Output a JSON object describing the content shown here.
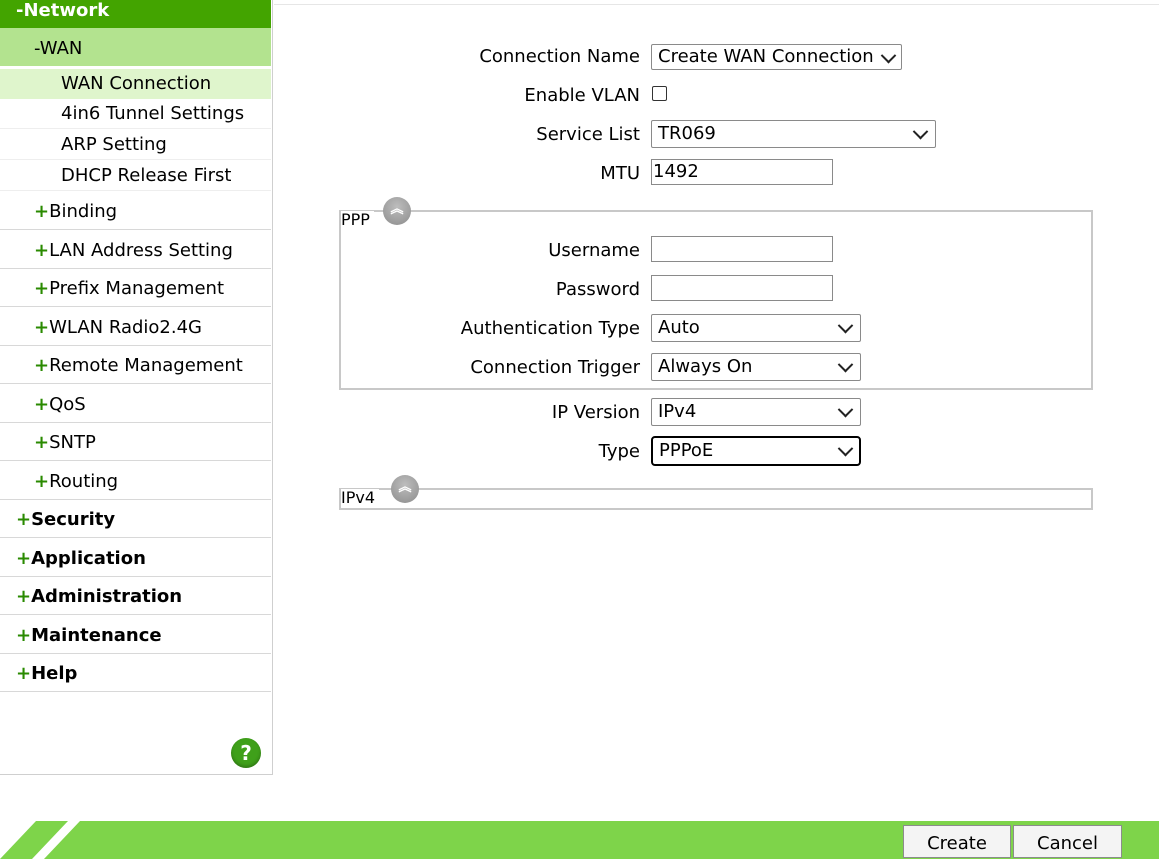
{
  "sidebar": {
    "network": "-Network",
    "wan": "-WAN",
    "wan_items": [
      "WAN Connection",
      "4in6 Tunnel Settings",
      "ARP Setting",
      "DHCP Release First"
    ],
    "network_items": [
      "Binding",
      "LAN Address Setting",
      "Prefix Management",
      "WLAN Radio2.4G",
      "Remote Management",
      "QoS",
      "SNTP",
      "Routing"
    ],
    "top_items": [
      "Security",
      "Application",
      "Administration",
      "Maintenance",
      "Help"
    ],
    "plus": "+",
    "help_icon": "?"
  },
  "form": {
    "connection_name_label": "Connection Name",
    "connection_name_value": "Create WAN Connection",
    "enable_vlan_label": "Enable VLAN",
    "service_list_label": "Service List",
    "service_list_value": "TR069",
    "mtu_label": "MTU",
    "mtu_value": "1492",
    "ppp_legend": "PPP",
    "username_label": "Username",
    "username_value": "",
    "password_label": "Password",
    "password_value": "",
    "auth_type_label": "Authentication Type",
    "auth_type_value": "Auto",
    "trigger_label": "Connection Trigger",
    "trigger_value": "Always On",
    "ip_version_label": "IP Version",
    "ip_version_value": "IPv4",
    "type_label": "Type",
    "type_value": "PPPoE",
    "ipv4_legend": "IPv4"
  },
  "footer": {
    "create_label": "Create",
    "cancel_label": "Cancel"
  },
  "icons": {
    "collapse": "double-chevron-up-icon",
    "help": "question-icon"
  },
  "colors": {
    "brand_green": "#43a400",
    "footer_green": "#7ed44a",
    "wan_highlight": "#b3e38f",
    "active_item": "#dff5cc"
  }
}
